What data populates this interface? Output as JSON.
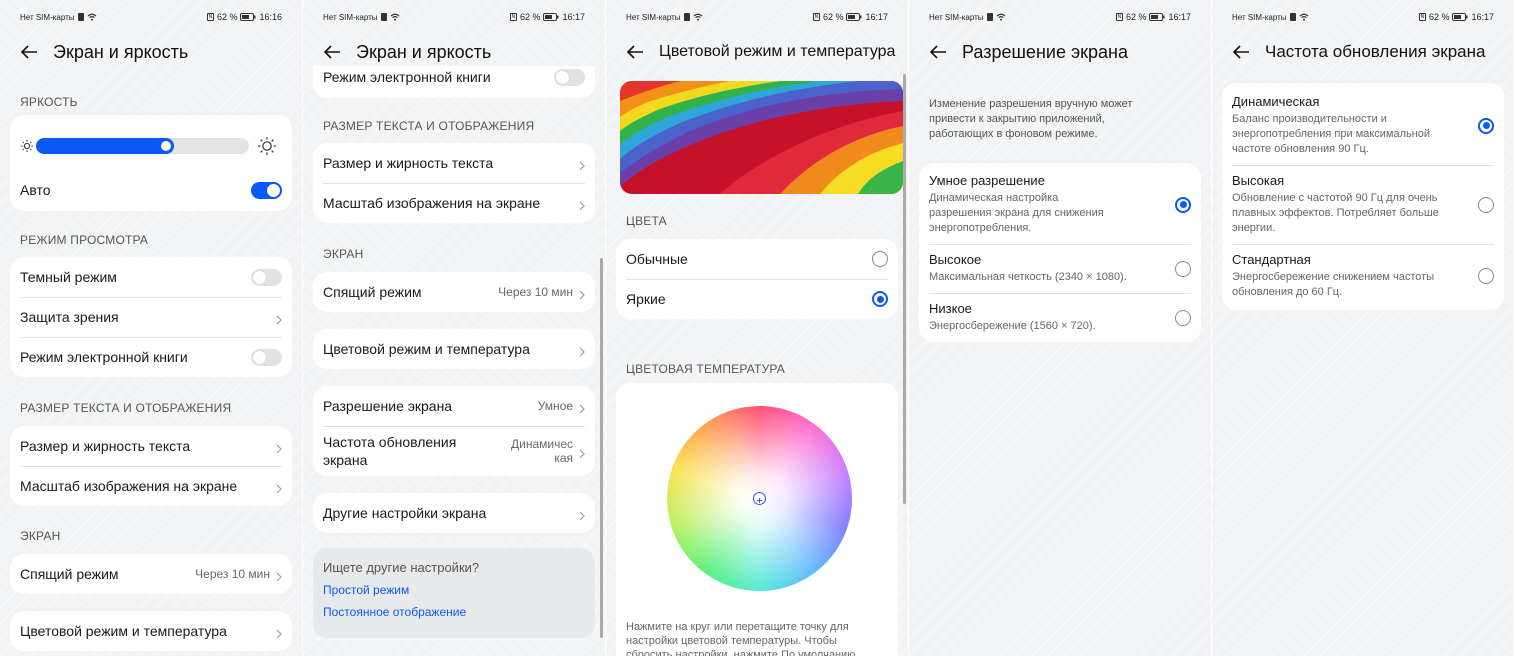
{
  "status": {
    "carrier": "Нет SIM-карты",
    "battery": "62 %",
    "times": [
      "16:16",
      "16:17",
      "16:17",
      "16:17",
      "16:17"
    ]
  },
  "s1": {
    "title": "Экран и яркость",
    "brightness_header": "ЯРКОСТЬ",
    "brightness_level": 0.65,
    "auto_label": "Авто",
    "auto_on": true,
    "view_header": "РЕЖИМ ПРОСМОТРА",
    "dark_mode": "Темный режим",
    "eye_comfort": "Защита зрения",
    "ebook": "Режим электронной книги",
    "text_header": "РАЗМЕР ТЕКСТА И ОТОБРАЖЕНИЯ",
    "text_size": "Размер и жирность текста",
    "display_scale": "Масштаб изображения на экране",
    "screen_header": "ЭКРАН",
    "sleep": "Спящий режим",
    "sleep_value": "Через 10 мин",
    "color_mode": "Цветовой режим и температура"
  },
  "s2": {
    "title": "Экран и яркость",
    "ebook": "Режим электронной книги",
    "text_header": "РАЗМЕР ТЕКСТА И ОТОБРАЖЕНИЯ",
    "text_size": "Размер и жирность текста",
    "display_scale": "Масштаб изображения на экране",
    "screen_header": "ЭКРАН",
    "sleep": "Спящий режим",
    "sleep_value": "Через 10 мин",
    "color_mode": "Цветовой режим и температура",
    "resolution": "Разрешение экрана",
    "resolution_value": "Умное",
    "refresh_line1": "Частота обновления",
    "refresh_line2": "экрана",
    "refresh_value_line1": "Динамичес",
    "refresh_value_line2": "кая",
    "other": "Другие настройки экрана",
    "search_title": "Ищете другие настройки?",
    "link_simple": "Простой режим",
    "link_aod": "Постоянное отображение"
  },
  "s3": {
    "title": "Цветовой режим и температура",
    "colors_header": "ЦВЕТА",
    "normal": "Обычные",
    "vivid": "Яркие",
    "selected": "vivid",
    "temp_header": "ЦВЕТОВАЯ ТЕМПЕРАТУРА",
    "hint_line1": "Нажмите на круг или перетащите точку для",
    "hint_line2": "настройки цветовой температуры. Чтобы",
    "hint_line3": "сбросить настройки, нажмите По умолчанию"
  },
  "s4": {
    "title": "Разрешение экрана",
    "desc_line1": "Изменение разрешения вручную может",
    "desc_line2": "привести к закрытию приложений,",
    "desc_line3": "работающих в фоновом режиме.",
    "smart_title": "Умное разрешение",
    "smart_desc1": "Динамическая настройка",
    "smart_desc2": "разрешения экрана для снижения",
    "smart_desc3": "энергопотребления.",
    "high_title": "Высокое",
    "high_desc": "Максимальная четкость (2340 × 1080).",
    "low_title": "Низкое",
    "low_desc": "Энергосбережение (1560 × 720).",
    "selected": "smart"
  },
  "s5": {
    "title": "Частота обновления экрана",
    "dyn_title": "Динамическая",
    "dyn_desc1": "Баланс производительности и",
    "dyn_desc2": "энергопотребления при максимальной",
    "dyn_desc3": "частоте обновления 90 Гц.",
    "high_title": "Высокая",
    "high_desc1": "Обновление с частотой 90 Гц для очень",
    "high_desc2": "плавных эффектов. Потребляет больше",
    "high_desc3": "энергии.",
    "std_title": "Стандартная",
    "std_desc1": "Энергосбережение снижением частоты",
    "std_desc2": "обновления до 60 Гц.",
    "selected": "dynamic"
  },
  "colors": {
    "accent": "#0a59f7",
    "background": "#f1f3f5",
    "card": "#ffffff"
  }
}
